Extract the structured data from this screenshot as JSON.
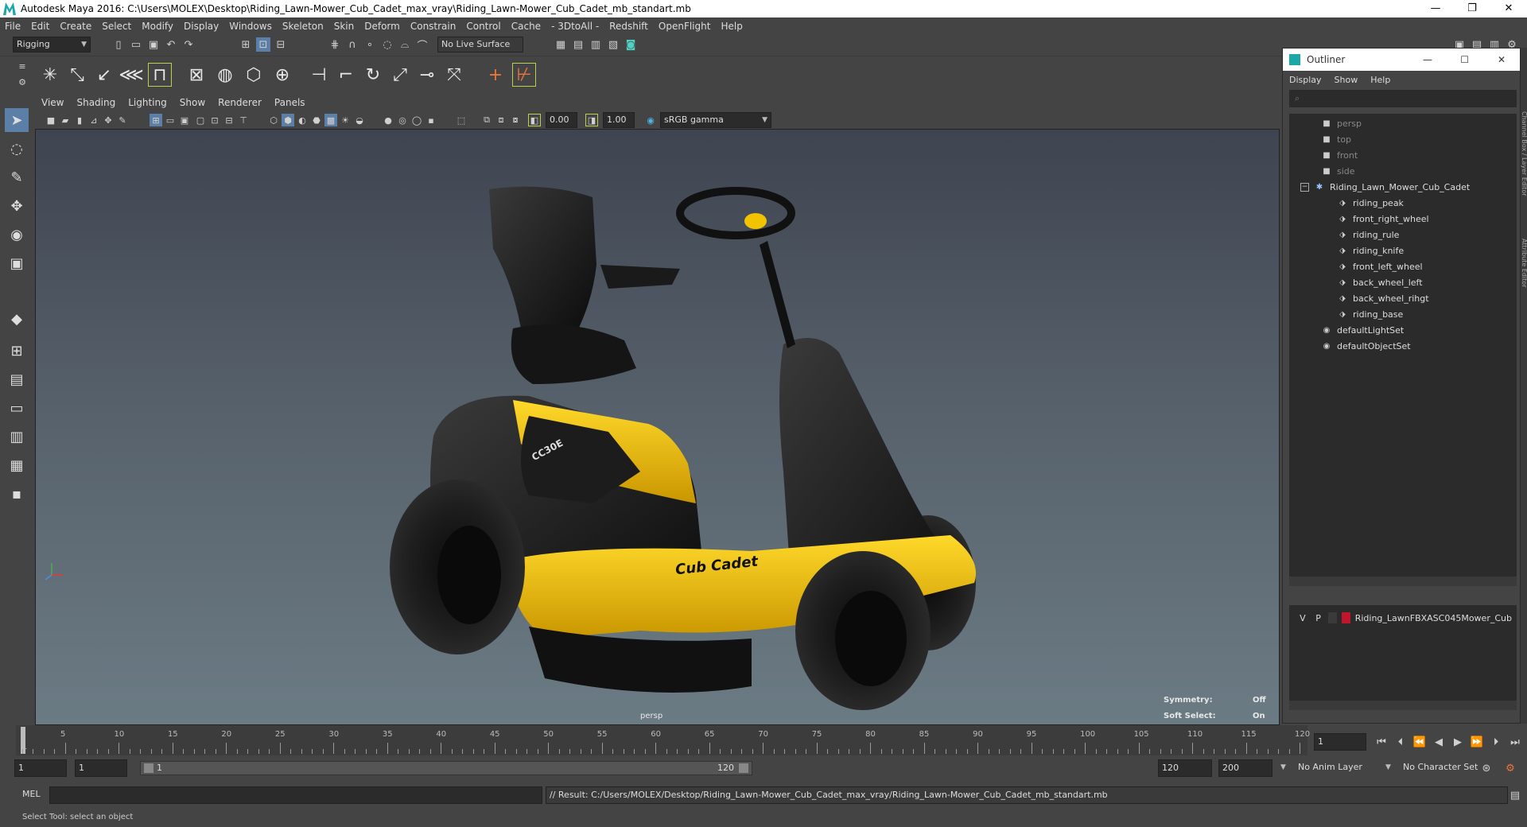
{
  "window": {
    "title": "Autodesk Maya 2016: C:\\Users\\MOLEX\\Desktop\\Riding_Lawn-Mower_Cub_Cadet_max_vray\\Riding_Lawn-Mower_Cub_Cadet_mb_standart.mb",
    "minimize": "—",
    "restore": "❐",
    "close": "✕"
  },
  "menubar": [
    "File",
    "Edit",
    "Create",
    "Select",
    "Modify",
    "Display",
    "Windows",
    "Skeleton",
    "Skin",
    "Deform",
    "Constrain",
    "Control",
    "Cache",
    "- 3DtoAll -",
    "Redshift",
    "OpenFlight",
    "Help"
  ],
  "statusline": {
    "menuset": "Rigging",
    "live_surface": "No Live Surface"
  },
  "panel_menu": [
    "View",
    "Shading",
    "Lighting",
    "Show",
    "Renderer",
    "Panels"
  ],
  "panel_toolbar": {
    "near_value": "0.00",
    "far_value": "1.00",
    "color_space": "sRGB gamma"
  },
  "viewport": {
    "camera_label": "persp",
    "hud": {
      "symmetry_label": "Symmetry:",
      "symmetry_value": "Off",
      "soft_select_label": "Soft Select:",
      "soft_select_value": "On"
    },
    "model": {
      "brand": "Cub Cadet",
      "badge": "CC30E"
    },
    "colors": {
      "body_yellow": "#f2c300",
      "body_black": "#1a1a1a",
      "bg_top": "#3e4450",
      "bg_bottom": "#6b7b84"
    }
  },
  "outliner": {
    "title": "Outliner",
    "menu": [
      "Display",
      "Show",
      "Help"
    ],
    "items": [
      {
        "name": "persp",
        "type": "camera",
        "dim": true
      },
      {
        "name": "top",
        "type": "camera",
        "dim": true
      },
      {
        "name": "front",
        "type": "camera",
        "dim": true
      },
      {
        "name": "side",
        "type": "camera",
        "dim": true
      },
      {
        "name": "Riding_Lawn_Mower_Cub_Cadet",
        "type": "group",
        "dim": false
      },
      {
        "name": "riding_peak",
        "type": "mesh",
        "dim": false
      },
      {
        "name": "front_right_wheel",
        "type": "mesh",
        "dim": false
      },
      {
        "name": "riding_rule",
        "type": "mesh",
        "dim": false
      },
      {
        "name": "riding_knife",
        "type": "mesh",
        "dim": false
      },
      {
        "name": "front_left_wheel",
        "type": "mesh",
        "dim": false
      },
      {
        "name": "back_wheel_left",
        "type": "mesh",
        "dim": false
      },
      {
        "name": "back_wheel_rihgt",
        "type": "mesh",
        "dim": false
      },
      {
        "name": "riding_base",
        "type": "mesh",
        "dim": false
      },
      {
        "name": "defaultLightSet",
        "type": "set",
        "dim": false
      },
      {
        "name": "defaultObjectSet",
        "type": "set",
        "dim": false
      }
    ],
    "layer": {
      "v": "V",
      "p": "P",
      "name": "Riding_LawnFBXASC045Mower_Cub",
      "color": "#c0162c"
    }
  },
  "side_tabs": {
    "channel_box": "Channel Box / Layer Editor",
    "attribute_editor": "Attribute Editor"
  },
  "timeline": {
    "ticks": [
      "5",
      "10",
      "15",
      "20",
      "25",
      "30",
      "35",
      "40",
      "45",
      "50",
      "55",
      "60",
      "65",
      "70",
      "75",
      "80",
      "85",
      "90",
      "95",
      "100",
      "105",
      "110",
      "115",
      "120"
    ],
    "first_frame_label": "1",
    "current_frame": "1"
  },
  "range": {
    "start": "1",
    "inner_start": "1",
    "slider_start": "1",
    "slider_end": "120",
    "end": "120",
    "max": "200",
    "anim_layer": "No Anim Layer",
    "character_set": "No Character Set"
  },
  "command": {
    "label": "MEL",
    "result": "// Result: C:/Users/MOLEX/Desktop/Riding_Lawn-Mower_Cub_Cadet_max_vray/Riding_Lawn-Mower_Cub_Cadet_mb_standart.mb"
  },
  "help_line": "Select Tool: select an object"
}
